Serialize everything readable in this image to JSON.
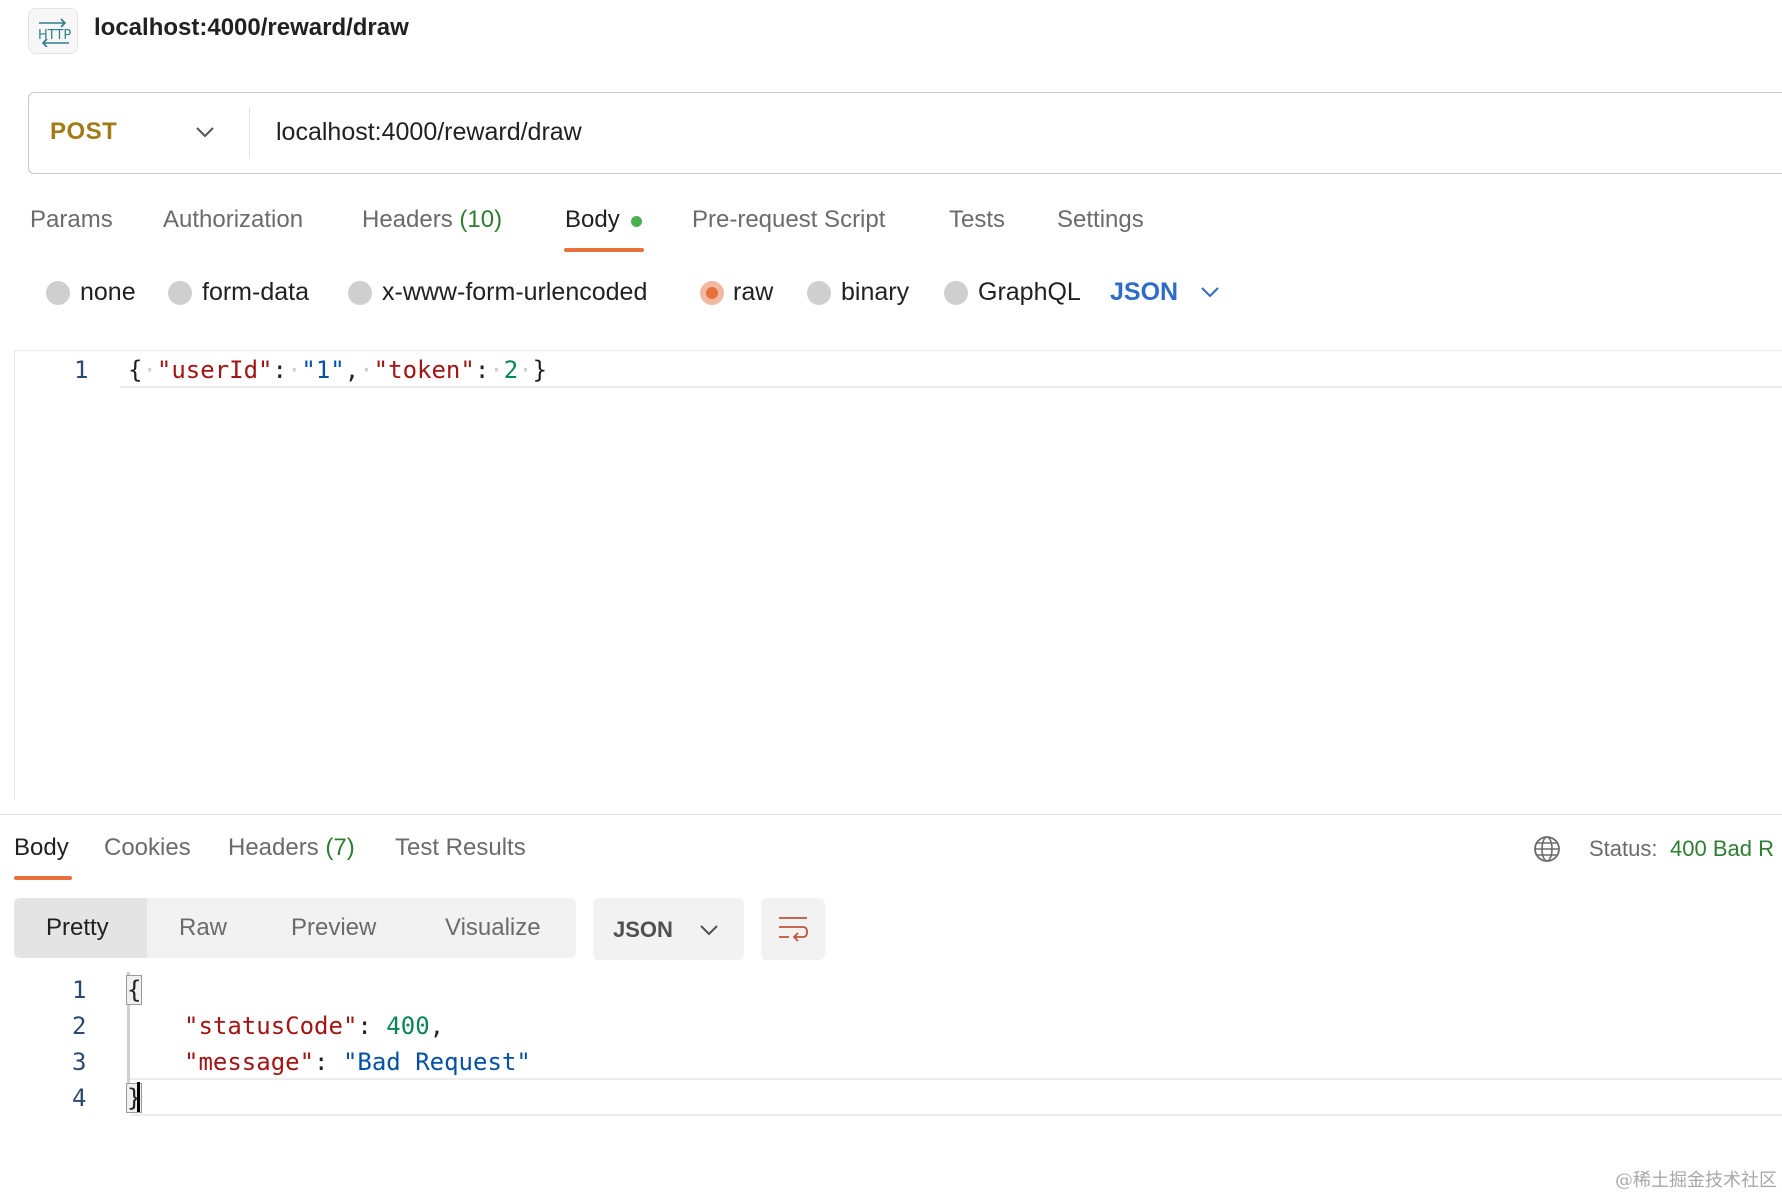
{
  "header": {
    "badge_icon": "http-icon",
    "title": "localhost:4000/reward/draw"
  },
  "url_bar": {
    "method": "POST",
    "url": "localhost:4000/reward/draw"
  },
  "request_tabs": [
    {
      "label": "Params"
    },
    {
      "label": "Authorization"
    },
    {
      "label": "Headers",
      "count": "(10)"
    },
    {
      "label": "Body",
      "active": true
    },
    {
      "label": "Pre-request Script"
    },
    {
      "label": "Tests"
    },
    {
      "label": "Settings"
    }
  ],
  "body_options": {
    "modes": [
      "none",
      "form-data",
      "x-www-form-urlencoded",
      "raw",
      "binary",
      "GraphQL"
    ],
    "selected": "raw",
    "format": "JSON"
  },
  "request_editor": {
    "lines": [
      {
        "number": "1",
        "text": "{ \"userId\": \"1\", \"token\": 2 }"
      }
    ],
    "tokens": {
      "open": "{",
      "key1": "\"userId\"",
      "colon": ":",
      "val1": "\"1\"",
      "comma": ",",
      "key2": "\"token\"",
      "val2": "2",
      "close": "}"
    }
  },
  "response_tabs": [
    {
      "label": "Body",
      "active": true
    },
    {
      "label": "Cookies"
    },
    {
      "label": "Headers",
      "count": "(7)"
    },
    {
      "label": "Test Results"
    }
  ],
  "status": {
    "label": "Status:",
    "value": "400 Bad R"
  },
  "view_modes": [
    "Pretty",
    "Raw",
    "Preview",
    "Visualize"
  ],
  "response_format": "JSON",
  "response_editor": {
    "line_numbers": [
      "1",
      "2",
      "3",
      "4"
    ],
    "open": "{",
    "close": "}",
    "key1": "\"statusCode\"",
    "val1": "400",
    "key2": "\"message\"",
    "val2": "\"Bad Request\"",
    "colon": ":",
    "comma": ","
  },
  "watermark": "@稀土掘金技术社区",
  "colors": {
    "accent": "#e8703a",
    "method": "#a27a17",
    "json_link": "#2f6bc9",
    "status_ok_text": "#2e7d32"
  }
}
